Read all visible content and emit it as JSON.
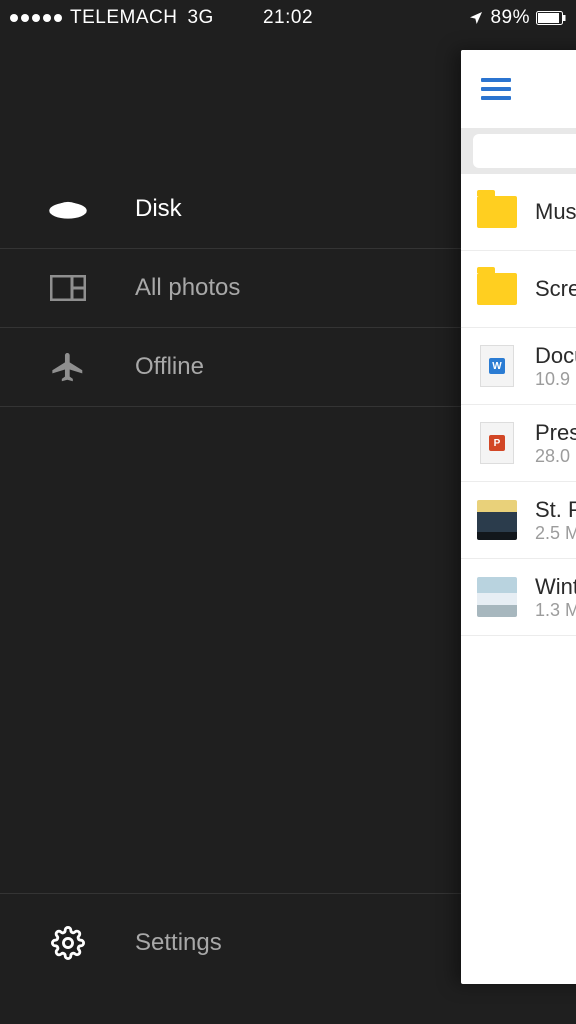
{
  "status_bar": {
    "carrier": "TELEMACH",
    "network": "3G",
    "time": "21:02",
    "battery_pct": "89%"
  },
  "sidebar": {
    "items": [
      {
        "label": "Disk"
      },
      {
        "label": "All photos"
      },
      {
        "label": "Offline"
      }
    ],
    "settings_label": "Settings"
  },
  "files": [
    {
      "name": "Musi",
      "meta": ""
    },
    {
      "name": "Scre",
      "meta": ""
    },
    {
      "name": "Docu",
      "meta": "10.9 "
    },
    {
      "name": "Pres",
      "meta": "28.0 "
    },
    {
      "name": "St. P",
      "meta": "2.5 M"
    },
    {
      "name": "Wint",
      "meta": "1.3 M"
    }
  ]
}
